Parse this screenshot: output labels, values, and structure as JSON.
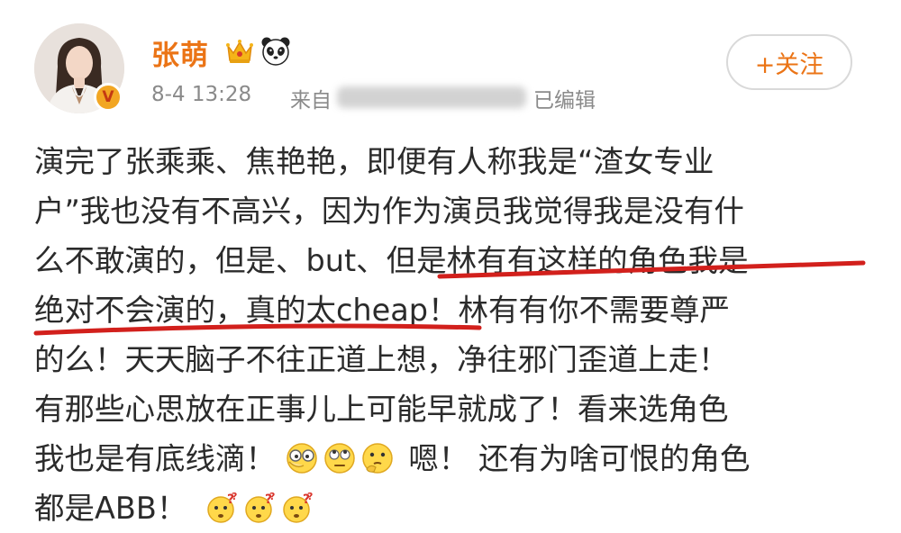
{
  "post": {
    "username": "张萌",
    "timestamp": "8-4 13:28",
    "source_prefix": "来自",
    "edited_label": "已编辑",
    "follow_label": "+关注",
    "badges": [
      "crown-icon",
      "panda-icon",
      "verified-badge-icon"
    ],
    "lines": [
      "演完了张乘乘、焦艳艳，即便有人称我是“渣女专业",
      "户”我也没有不高兴，因为作为演员我觉得我是没有什",
      "么不敢演的，但是、but、但是林有有这样的角色我是",
      "绝对不会演的，真的太cheap！林有有你不需要尊严",
      "的么！天天脑子不往正道上想，净往邪门歪道上走！",
      "有那些心思放在正事儿上可能早就成了！看来选角色"
    ],
    "line7": {
      "before": "我也是有底线滴！",
      "after": "嗯！ 还有为啥可恨的角色"
    },
    "line8": {
      "before": "都是ABB！"
    }
  },
  "colors": {
    "username": "#eb7416",
    "underline": "#d2201c",
    "meta": "#8a8a8a"
  }
}
